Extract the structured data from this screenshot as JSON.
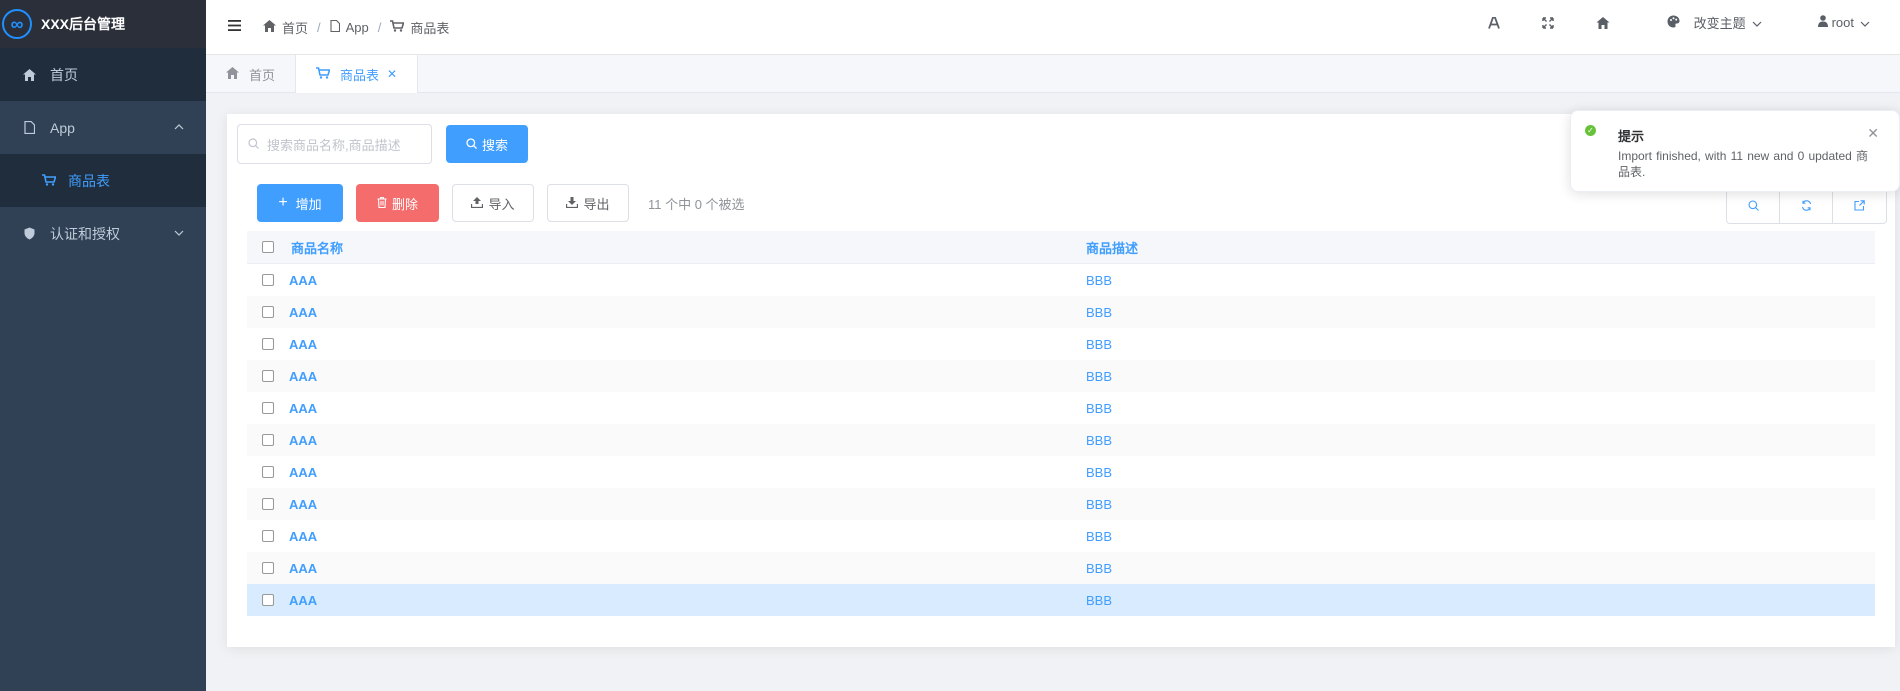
{
  "app": {
    "title": "XXX后台管理",
    "logo_glyph": "∞"
  },
  "sidebar": {
    "items": [
      {
        "label": "首页",
        "icon": "home-icon"
      },
      {
        "label": "App",
        "icon": "file-icon",
        "expanded": true
      },
      {
        "label": "商品表",
        "icon": "cart-icon",
        "active": true
      },
      {
        "label": "认证和授权",
        "icon": "shield-icon",
        "expanded": false
      }
    ]
  },
  "header": {
    "breadcrumb": [
      "首页",
      "App",
      "商品表"
    ],
    "theme_label": "改变主题",
    "user": "root"
  },
  "tags": [
    {
      "label": "首页"
    },
    {
      "label": "商品表",
      "active": true
    }
  ],
  "search": {
    "placeholder": "搜索商品名称,商品描述",
    "button": "搜索"
  },
  "actions": {
    "add": "增加",
    "delete": "删除",
    "import": "导入",
    "export": "导出",
    "selection_text": "11 个中 0 个被选"
  },
  "table": {
    "columns": [
      "商品名称",
      "商品描述"
    ],
    "rows": [
      [
        "AAA",
        "BBB"
      ],
      [
        "AAA",
        "BBB"
      ],
      [
        "AAA",
        "BBB"
      ],
      [
        "AAA",
        "BBB"
      ],
      [
        "AAA",
        "BBB"
      ],
      [
        "AAA",
        "BBB"
      ],
      [
        "AAA",
        "BBB"
      ],
      [
        "AAA",
        "BBB"
      ],
      [
        "AAA",
        "BBB"
      ],
      [
        "AAA",
        "BBB"
      ],
      [
        "AAA",
        "BBB"
      ]
    ]
  },
  "notification": {
    "title": "提示",
    "message": "Import finished, with 11 new and 0 updated 商品表."
  },
  "colors": {
    "primary": "#409eff",
    "danger": "#f56c6c",
    "success": "#67c23a",
    "sidebar": "#304156"
  }
}
